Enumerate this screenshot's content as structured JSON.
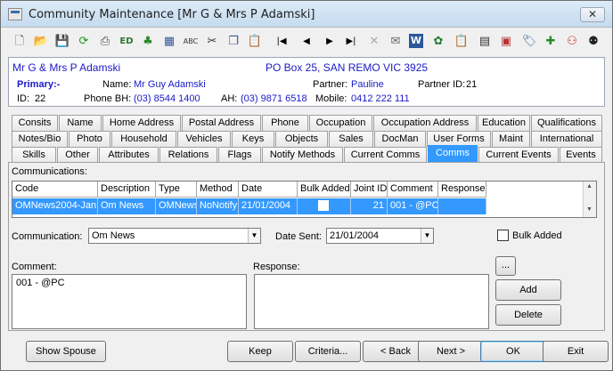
{
  "window": {
    "title": "Community Maintenance  [Mr G & Mrs P Adamski]",
    "close": "✕"
  },
  "toolbar": [
    "new-icon",
    "open-icon",
    "save-icon",
    "refresh-icon",
    "print-icon",
    "edit-id-icon",
    "tree-icon",
    "calculator-icon",
    "spellcheck-icon",
    "cut-icon",
    "copy-icon",
    "paste-icon",
    "first-icon",
    "prev-icon",
    "next-icon",
    "last-icon",
    "delete-icon",
    "email-icon",
    "word-icon",
    "excel-icon",
    "clipboard-icon",
    "calendar-icon",
    "report-icon",
    "tag-icon",
    "add-note-icon",
    "people-icon"
  ],
  "header": {
    "name": "Mr G & Mrs P Adamski",
    "address": "PO Box 25, SAN REMO VIC 3925",
    "primary_label": "Primary:-",
    "name_label": "Name:",
    "name_value": "Mr Guy Adamski",
    "partner_label": "Partner:",
    "partner_value": "Pauline",
    "partner_id_label": "Partner ID:",
    "partner_id_value": "21",
    "id_label": "ID:",
    "id_value": "22",
    "phone_bh_label": "Phone BH:",
    "phone_bh_value": "(03) 8544 1400",
    "ah_label": "AH:",
    "ah_value": "(03) 9871 6518",
    "mobile_label": "Mobile:",
    "mobile_value": "0412 222 111"
  },
  "tabs": {
    "row1": [
      "Consits",
      "Name",
      "Home Address",
      "Postal Address",
      "Phone",
      "Occupation",
      "Occupation Address",
      "Education",
      "Qualifications"
    ],
    "row2": [
      "Notes/Bio",
      "Photo",
      "Household",
      "Vehicles",
      "Keys",
      "Objects",
      "Sales",
      "DocMan",
      "User Forms",
      "Maint",
      "International"
    ],
    "row3": [
      "Skills",
      "Other",
      "Attributes",
      "Relations",
      "Flags",
      "Notify Methods",
      "Current Comms",
      "Comms",
      "Current Events",
      "Events"
    ],
    "active": "Comms"
  },
  "comms": {
    "section_label": "Communications:",
    "columns": [
      "Code",
      "Description",
      "Type",
      "Method",
      "Date",
      "Bulk Added",
      "Joint ID",
      "Comment",
      "Response"
    ],
    "row": {
      "code": "OMNews2004-Jan",
      "description": "Om News",
      "type": "OMNews",
      "method": "NoNotify",
      "date": "21/01/2004",
      "bulk_added": false,
      "joint_id": "21",
      "comment": "001 - @PC",
      "response": ""
    },
    "communication_label": "Communication:",
    "communication_value": "Om News",
    "date_sent_label": "Date Sent:",
    "date_sent_value": "21/01/2004",
    "bulk_added_label": "Bulk Added",
    "comment_label": "Comment:",
    "comment_value": "001 - @PC",
    "response_label": "Response:",
    "response_value": "",
    "ellipsis": "...",
    "add": "Add",
    "delete": "Delete"
  },
  "bottom": {
    "show_spouse": "Show Spouse",
    "keep": "Keep",
    "criteria": "Criteria...",
    "back": "< Back",
    "next": "Next >",
    "ok": "OK",
    "exit": "Exit"
  }
}
